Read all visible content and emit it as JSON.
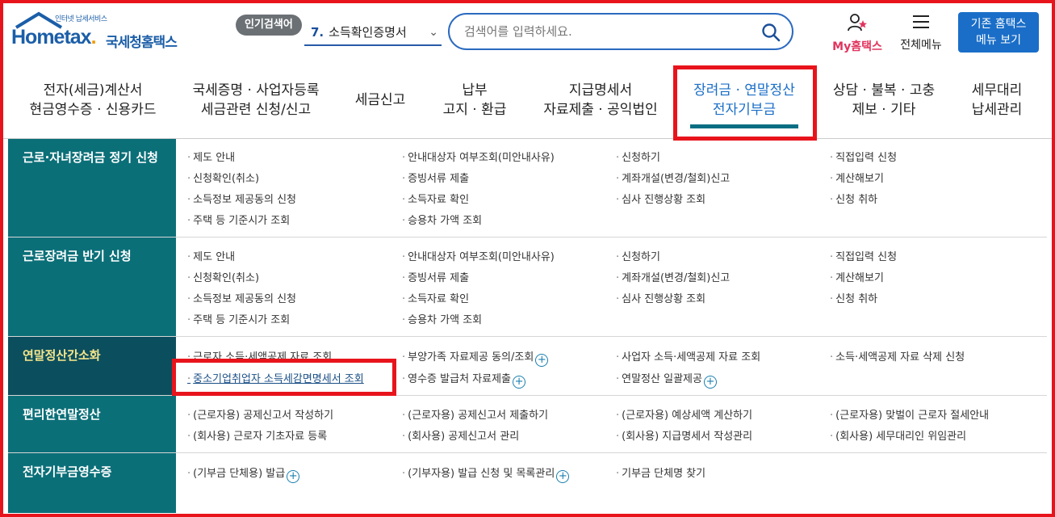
{
  "header": {
    "logo_tag": "인터넷 납세서비스",
    "logo_word": "Hometax",
    "logo_dot": ".",
    "logo_korean": "국세청홈택스",
    "popular_label": "인기검색어",
    "popular_rank": "7.",
    "popular_term": "소득확인증명서",
    "search_placeholder": "검색어를 입력하세요.",
    "my_home_label": "My홈택스",
    "all_menu_label": "전체메뉴",
    "old_menu_line1": "기존 홈택스",
    "old_menu_line2": "메뉴 보기"
  },
  "gnb": [
    {
      "line1": "전자(세금)계산서",
      "line2": "현금영수증 · 신용카드"
    },
    {
      "line1": "국세증명 · 사업자등록",
      "line2": "세금관련 신청/신고"
    },
    {
      "line1": "세금신고",
      "line2": ""
    },
    {
      "line1": "납부",
      "line2": "고지 · 환급"
    },
    {
      "line1": "지급명세서",
      "line2": "자료제출 · 공익법인"
    },
    {
      "line1": "장려금 · 연말정산",
      "line2": "전자기부금"
    },
    {
      "line1": "상담 · 불복 · 고충",
      "line2": "제보 · 기타"
    },
    {
      "line1": "세무대리",
      "line2": "납세관리"
    }
  ],
  "rows": [
    {
      "title": "근로·자녀장려금 정기 신청",
      "items": [
        "제도 안내",
        "안내대상자 여부조회(미안내사유)",
        "신청하기",
        "직접입력 신청",
        "신청확인(취소)",
        "증빙서류 제출",
        "계좌개설(변경/철회)신고",
        "계산해보기",
        "소득정보 제공동의 신청",
        "소득자료 확인",
        "심사 진행상황 조회",
        "신청 취하",
        "주택 등 기준시가 조회",
        "승용차 가액 조회"
      ]
    },
    {
      "title": "근로장려금 반기 신청",
      "items": [
        "제도 안내",
        "안내대상자 여부조회(미안내사유)",
        "신청하기",
        "직접입력 신청",
        "신청확인(취소)",
        "증빙서류 제출",
        "계좌개설(변경/철회)신고",
        "계산해보기",
        "소득정보 제공동의 신청",
        "소득자료 확인",
        "심사 진행상황 조회",
        "신청 취하",
        "주택 등 기준시가 조회",
        "승용차 가액 조회"
      ]
    },
    {
      "title": "연말정산간소화",
      "items": [
        "근로자 소득·세액공제 자료 조회",
        "부양가족 자료제공 동의/조회",
        "사업자 소득·세액공제 자료 조회",
        "소득·세액공제 자료 삭제 신청",
        "중소기업취업자 소득세감면명세서 조회",
        "영수증 발급처 자료제출",
        "연말정산 일괄제공"
      ]
    },
    {
      "title": "편리한연말정산",
      "items": [
        "(근로자용) 공제신고서 작성하기",
        "(근로자용) 공제신고서 제출하기",
        "(근로자용) 예상세액 계산하기",
        "(근로자용) 맞벌이 근로자 절세안내",
        "(회사용) 근로자 기초자료 등록",
        "(회사용) 공제신고서 관리",
        "(회사용) 지급명세서 작성관리",
        "(회사용) 세무대리인 위임관리"
      ]
    },
    {
      "title": "전자기부금영수증",
      "items": [
        "(기부금 단체용) 발급",
        "(기부자용) 발급 신청 및 목록관리",
        "기부금 단체명 찾기"
      ]
    }
  ],
  "colors": {
    "accent": "#1a6ec8",
    "row_title_bg": "#0b6f78",
    "highlight": "#e8141c"
  },
  "icons": [
    "search-icon",
    "user-star-icon",
    "hamburger-icon",
    "plus-circle-icon",
    "chevron-down-icon"
  ]
}
